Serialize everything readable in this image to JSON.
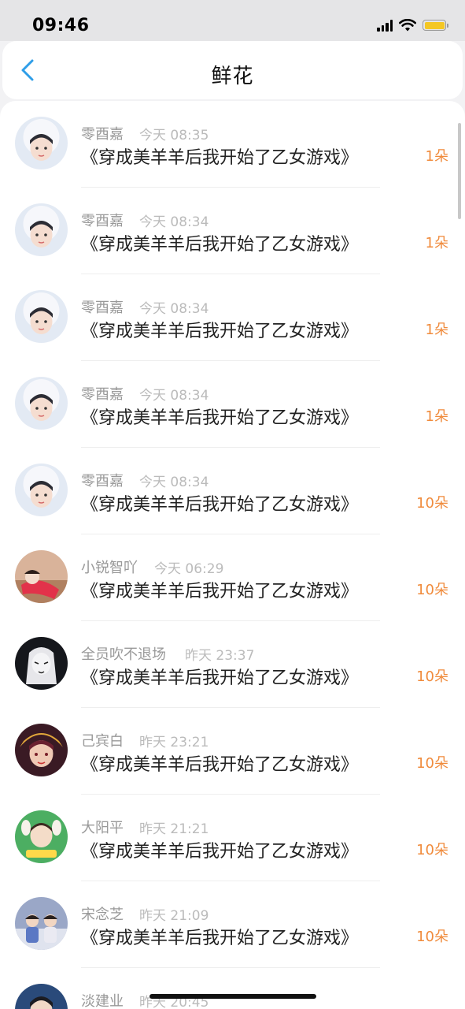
{
  "status_bar": {
    "time": "09:46",
    "battery_color": "#f4c724"
  },
  "header": {
    "title": "鲜花",
    "back_icon": "chevron-left-icon"
  },
  "accent_colors": {
    "count": "#f08b3c",
    "back": "#2f9ee8"
  },
  "items": [
    {
      "name": "零酉嘉",
      "time": "今天 08:35",
      "title": "《穿成美羊羊后我开始了乙女游戏》",
      "count": "1朵"
    },
    {
      "name": "零酉嘉",
      "time": "今天 08:34",
      "title": "《穿成美羊羊后我开始了乙女游戏》",
      "count": "1朵"
    },
    {
      "name": "零酉嘉",
      "time": "今天 08:34",
      "title": "《穿成美羊羊后我开始了乙女游戏》",
      "count": "1朵"
    },
    {
      "name": "零酉嘉",
      "time": "今天 08:34",
      "title": "《穿成美羊羊后我开始了乙女游戏》",
      "count": "1朵"
    },
    {
      "name": "零酉嘉",
      "time": "今天 08:34",
      "title": "《穿成美羊羊后我开始了乙女游戏》",
      "count": "10朵"
    },
    {
      "name": "小锐智吖",
      "time": "今天 06:29",
      "title": "《穿成美羊羊后我开始了乙女游戏》",
      "count": "10朵"
    },
    {
      "name": "全员吹不退场",
      "time": "昨天 23:37",
      "title": "《穿成美羊羊后我开始了乙女游戏》",
      "count": "10朵"
    },
    {
      "name": "己宾白",
      "time": "昨天 23:21",
      "title": "《穿成美羊羊后我开始了乙女游戏》",
      "count": "10朵"
    },
    {
      "name": "大阳平",
      "time": "昨天 21:21",
      "title": "《穿成美羊羊后我开始了乙女游戏》",
      "count": "10朵"
    },
    {
      "name": "宋念芝",
      "time": "昨天 21:09",
      "title": "《穿成美羊羊后我开始了乙女游戏》",
      "count": "10朵"
    },
    {
      "name": "淡建业",
      "time": "昨天 20:45",
      "title": "",
      "count": ""
    }
  ]
}
